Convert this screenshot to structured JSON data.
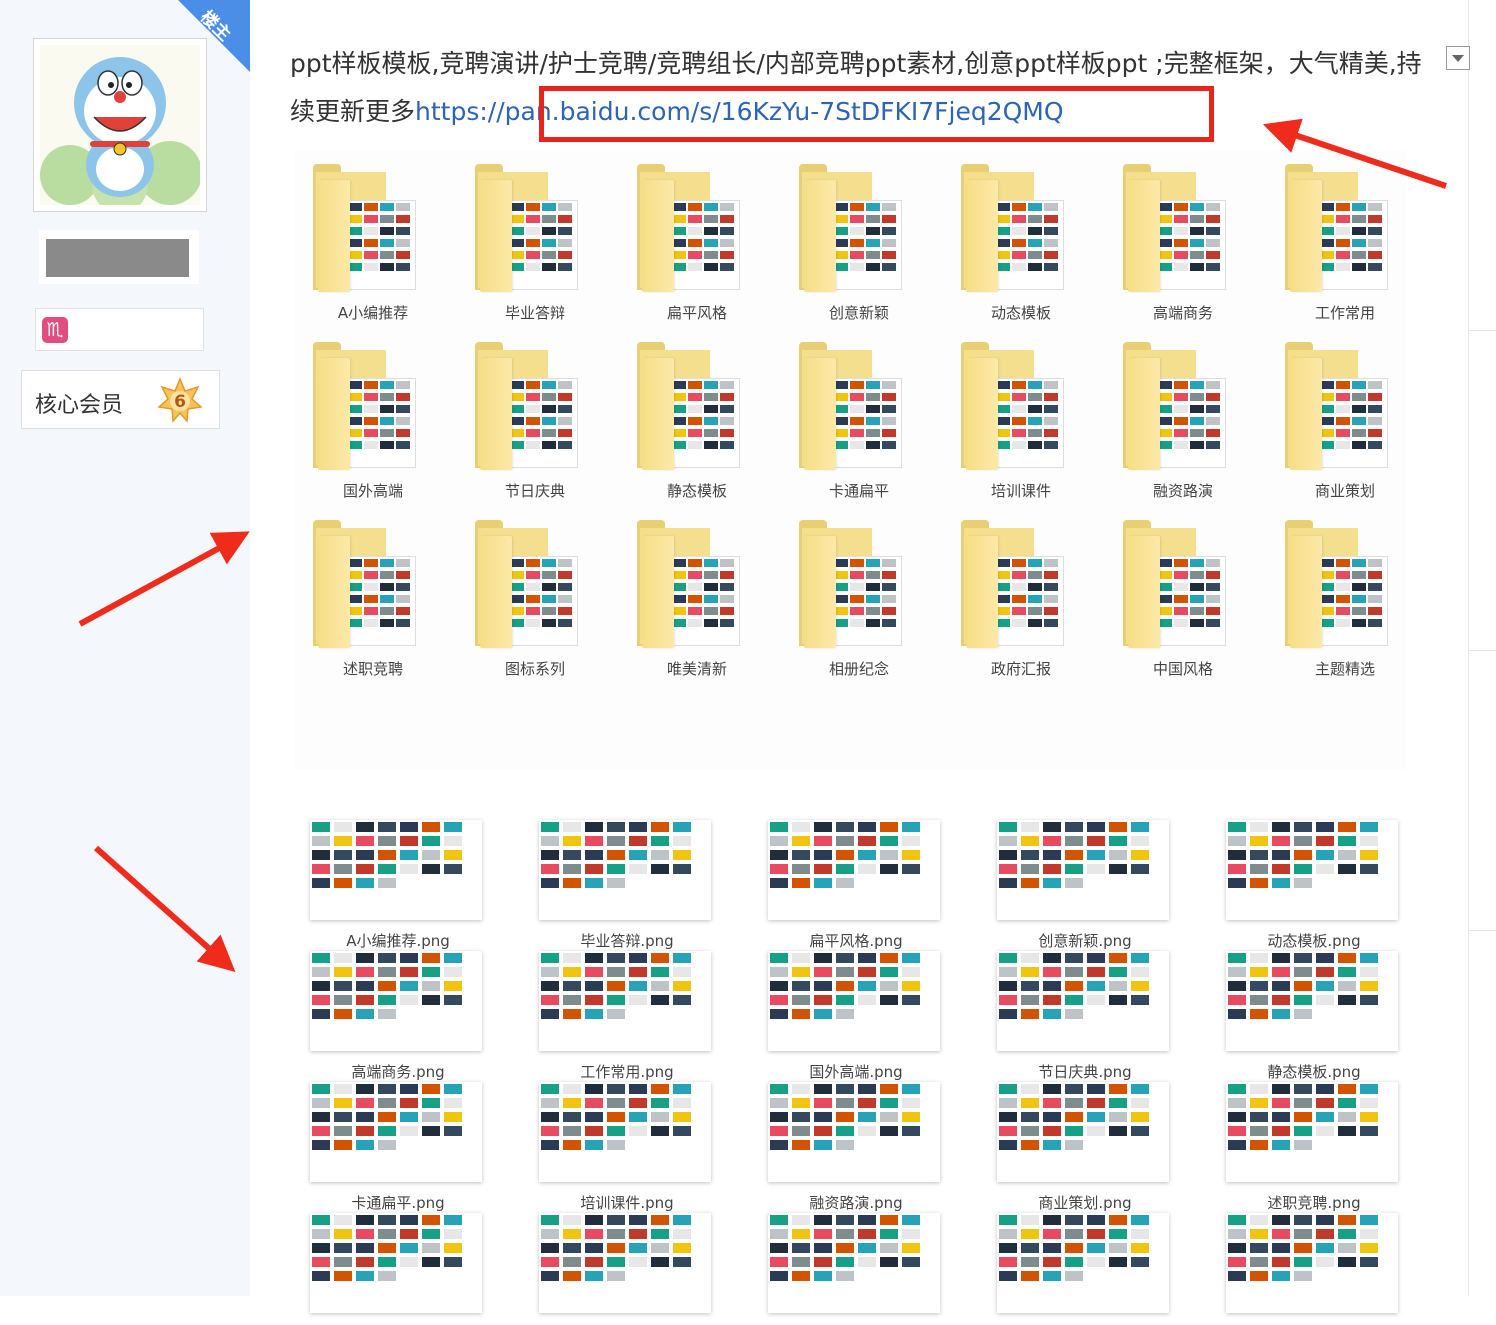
{
  "user_panel": {
    "ribbon_label": "楼主",
    "zodiac_glyph": "♏",
    "member_label": "核心会员",
    "member_level": "6"
  },
  "post": {
    "text": "ppt样板模板,竞聘演讲/护士竞聘/竞聘组长/内部竞聘ppt素材,创意ppt样板ppt ;完整框架，大气精美,持续更新更多",
    "link": "https://pan.baidu.com/s/16KzYu-7StDFKI7Fjeq2QMQ"
  },
  "folders": [
    "A小编推荐",
    "毕业答辩",
    "扁平风格",
    "创意新颖",
    "动态模板",
    "高端商务",
    "工作常用",
    "国外高端",
    "节日庆典",
    "静态模板",
    "卡通扁平",
    "培训课件",
    "融资路演",
    "商业策划",
    "述职竞聘",
    "图标系列",
    "唯美清新",
    "相册纪念",
    "政府汇报",
    "中国风格",
    "主题精选"
  ],
  "thumbnails": [
    "A小编推荐.png",
    "毕业答辩.png",
    "扁平风格.png",
    "创意新颖.png",
    "动态模板.png",
    "高端商务.png",
    "工作常用.png",
    "国外高端.png",
    "节日庆典.png",
    "静态模板.png",
    "卡通扁平.png",
    "培训课件.png",
    "融资路演.png",
    "商业策划.png",
    "述职竞聘.png",
    "",
    "",
    "",
    "",
    ""
  ],
  "colors": {
    "accent_red": "#e8251b",
    "link_blue": "#2d64b3",
    "ribbon_blue": "#4b8ee8",
    "folder_yellow": "#f4df8f"
  }
}
